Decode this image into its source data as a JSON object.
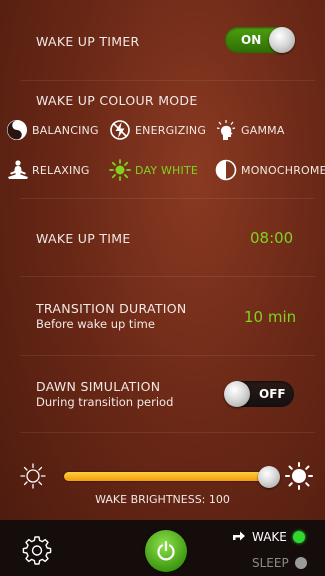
{
  "timer": {
    "label": "WAKE UP TIMER",
    "toggle_state": "ON"
  },
  "colour_mode": {
    "title": "WAKE UP COLOUR MODE",
    "modes": [
      {
        "label": "BALANCING",
        "icon": "yin-yang-icon"
      },
      {
        "label": "ENERGIZING",
        "icon": "lightning-icon"
      },
      {
        "label": "GAMMA",
        "icon": "head-glow-icon"
      },
      {
        "label": "RELAXING",
        "icon": "meditation-icon"
      },
      {
        "label": "DAY WHITE",
        "icon": "sun-burst-icon",
        "selected": true
      },
      {
        "label": "MONOCHROME",
        "icon": "half-circle-icon"
      }
    ]
  },
  "wake_time": {
    "label": "WAKE UP TIME",
    "value": "08:00"
  },
  "transition": {
    "label": "TRANSITION DURATION",
    "sublabel": "Before wake up time",
    "value": "10 min"
  },
  "dawn": {
    "label": "DAWN SIMULATION",
    "sublabel": "During transition period",
    "toggle_state": "OFF"
  },
  "brightness": {
    "label": "WAKE BRIGHTNESS: 100",
    "level_percent": 100
  },
  "bottom": {
    "wake_label": "WAKE",
    "sleep_label": "SLEEP"
  },
  "colors": {
    "accent": "#7fd321",
    "wake_dot": "#2ed82e",
    "sleep_dot": "#9a9a9a",
    "slider": "#f5a817"
  }
}
